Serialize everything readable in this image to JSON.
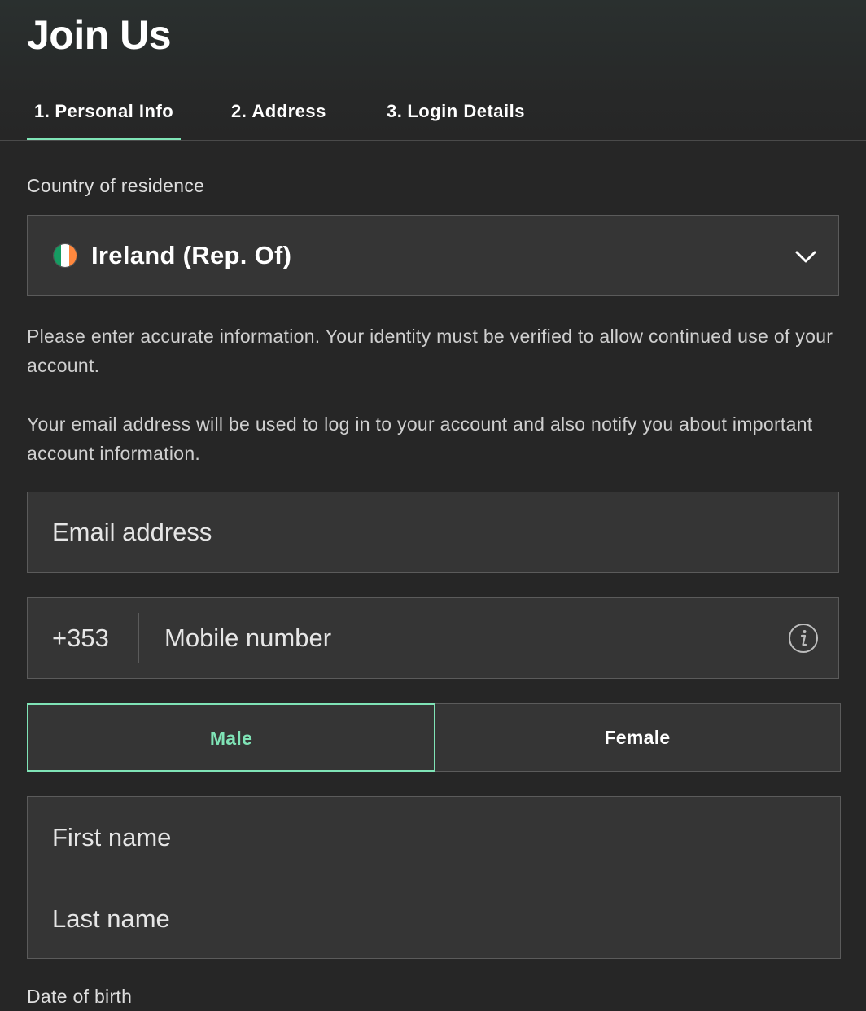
{
  "header": {
    "title": "Join Us"
  },
  "steps": [
    {
      "number": "1.",
      "label": "Personal Info",
      "active": true
    },
    {
      "number": "2.",
      "label": "Address",
      "active": false
    },
    {
      "number": "3.",
      "label": "Login Details",
      "active": false
    }
  ],
  "country": {
    "label": "Country of residence",
    "value": "Ireland (Rep. Of)",
    "flag_icon": "ireland-flag-icon",
    "flag_colors": [
      "#169b62",
      "#ffffff",
      "#ff883e"
    ]
  },
  "notices": {
    "identity": "Please enter accurate information. Your identity must be verified to allow continued use of your account.",
    "email": "Your email address will be used to log in to your account and also notify you about important account information."
  },
  "email": {
    "placeholder": "Email address"
  },
  "mobile": {
    "prefix": "+353",
    "placeholder": "Mobile number"
  },
  "gender": {
    "male": "Male",
    "female": "Female",
    "selected": "Male"
  },
  "name": {
    "first_placeholder": "First name",
    "last_placeholder": "Last name"
  },
  "dob": {
    "label": "Date of birth"
  },
  "colors": {
    "accent": "#7fe3b6",
    "background": "#262626",
    "field": "#353535"
  }
}
